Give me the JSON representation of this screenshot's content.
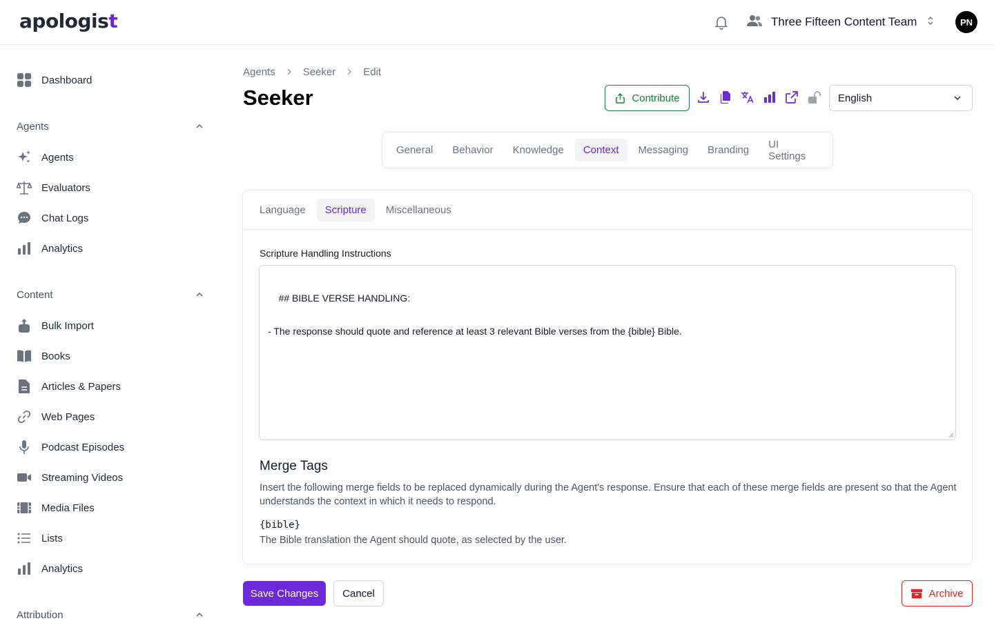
{
  "header": {
    "logo_text": "apologis",
    "logo_cross": "t",
    "team_name": "Three Fifteen Content Team",
    "avatar_initials": "PN"
  },
  "sidebar": {
    "dashboard": "Dashboard",
    "sections": [
      {
        "title": "Agents",
        "items": [
          "Agents",
          "Evaluators",
          "Chat Logs",
          "Analytics"
        ]
      },
      {
        "title": "Content",
        "items": [
          "Bulk Import",
          "Books",
          "Articles & Papers",
          "Web Pages",
          "Podcast Episodes",
          "Streaming Videos",
          "Media Files",
          "Lists",
          "Analytics"
        ]
      },
      {
        "title": "Attribution",
        "items": []
      }
    ]
  },
  "breadcrumb": [
    "Agents",
    "Seeker",
    "Edit"
  ],
  "page_title": "Seeker",
  "toolbar": {
    "contribute_label": "Contribute",
    "icons": [
      "download-icon",
      "copy-icon",
      "translate-icon",
      "analytics-icon",
      "external-link-icon",
      "unlock-icon"
    ],
    "language_selected": "English"
  },
  "tabs": {
    "items": [
      "General",
      "Behavior",
      "Knowledge",
      "Context",
      "Messaging",
      "Branding",
      "UI Settings"
    ],
    "active": "Context"
  },
  "subtabs": {
    "items": [
      "Language",
      "Scripture",
      "Miscellaneous"
    ],
    "active": "Scripture"
  },
  "scripture": {
    "label": "Scripture Handling Instructions",
    "value": "## BIBLE VERSE HANDLING:\n\n- The response should quote and reference at least 3 relevant Bible verses from the {bible} Bible."
  },
  "merge_tags": {
    "title": "Merge Tags",
    "description": "Insert the following merge fields to be replaced dynamically during the Agent's response. Ensure that each of these merge fields are present so that the Agent understands the context in which it needs to respond.",
    "tags": [
      {
        "tag": "{bible}",
        "description": "The Bible translation the Agent should quote, as selected by the user."
      }
    ]
  },
  "actions": {
    "save": "Save Changes",
    "cancel": "Cancel",
    "archive": "Archive"
  },
  "colors": {
    "accent": "#6d28d9",
    "contribute": "#15803d",
    "danger": "#dc2626",
    "sidebar_icon": "#6b7280"
  }
}
